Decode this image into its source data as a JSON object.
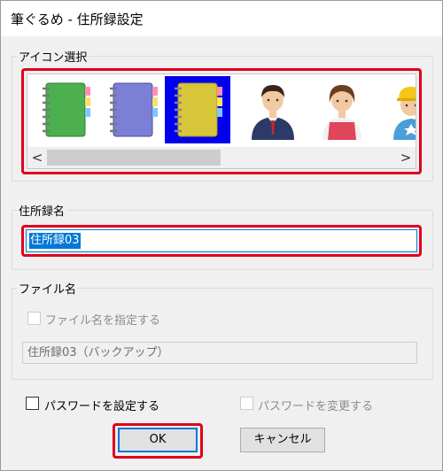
{
  "window": {
    "title": "筆ぐるめ - 住所録設定"
  },
  "icon_group": {
    "label": "アイコン選択",
    "icons": [
      {
        "name": "green-notebook-icon",
        "selected": false
      },
      {
        "name": "purple-notebook-icon",
        "selected": false
      },
      {
        "name": "yellow-notebook-icon",
        "selected": true
      },
      {
        "name": "businessman-icon",
        "selected": false
      },
      {
        "name": "woman-apron-icon",
        "selected": false
      },
      {
        "name": "child-helmet-icon",
        "selected": false
      }
    ],
    "scroll_left": "<",
    "scroll_right": ">"
  },
  "name_group": {
    "label": "住所録名",
    "value": "住所録03"
  },
  "file_group": {
    "label": "ファイル名",
    "specify_label": "ファイル名を指定する",
    "file_value": "住所録03（バックアップ）"
  },
  "password": {
    "set_label": "パスワードを設定する",
    "change_label": "パスワードを変更する"
  },
  "buttons": {
    "ok": "OK",
    "cancel": "キャンセル"
  },
  "colors": {
    "highlight_frame": "#e0001b",
    "selection_blue": "#0000ee",
    "focus_blue": "#0078d7"
  }
}
